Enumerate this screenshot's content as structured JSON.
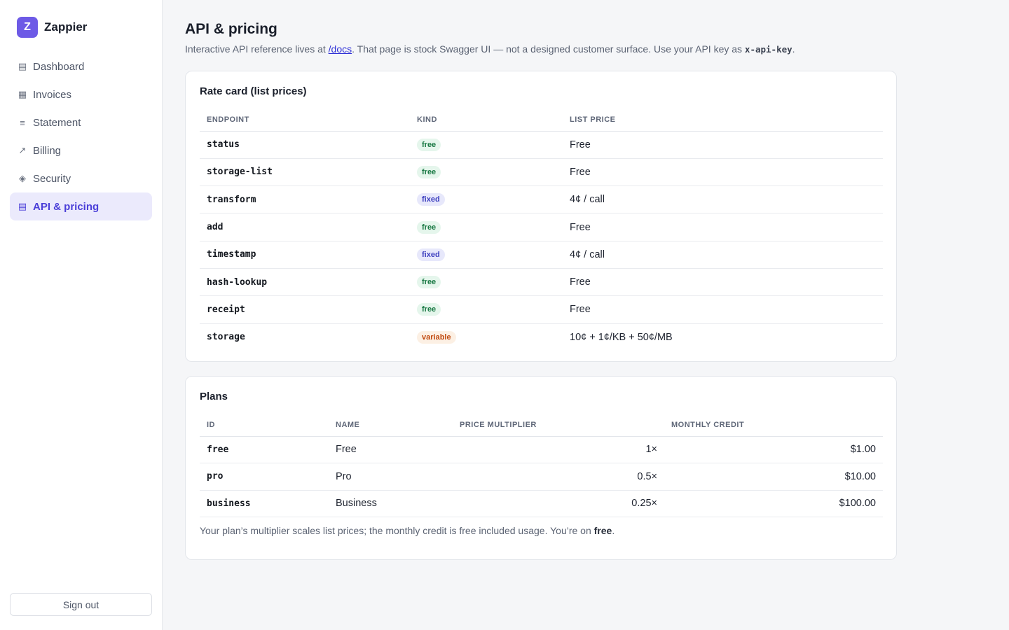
{
  "app": {
    "logo_letter": "Z",
    "name": "Zappier"
  },
  "sidebar": {
    "items": [
      {
        "label": "Dashboard",
        "icon": "▤"
      },
      {
        "label": "Invoices",
        "icon": "▦"
      },
      {
        "label": "Statement",
        "icon": "≡"
      },
      {
        "label": "Billing",
        "icon": "↗"
      },
      {
        "label": "Security",
        "icon": "◈"
      },
      {
        "label": "API & pricing",
        "icon": "▤"
      }
    ],
    "active_index": 5,
    "signout_label": "Sign out"
  },
  "page": {
    "title": "API & pricing",
    "subtitle_pre": "Interactive API reference lives at ",
    "subtitle_link": "/docs",
    "subtitle_mid": ". That page is stock Swagger UI — not a designed customer surface. Use your API key as ",
    "subtitle_code": "x-api-key",
    "subtitle_post": "."
  },
  "rate_card": {
    "title": "Rate card (list prices)",
    "columns": [
      "ENDPOINT",
      "KIND",
      "LIST PRICE"
    ],
    "rows": [
      {
        "endpoint": "status",
        "kind": "free",
        "price": "Free"
      },
      {
        "endpoint": "storage-list",
        "kind": "free",
        "price": "Free"
      },
      {
        "endpoint": "transform",
        "kind": "fixed",
        "price": "4¢ / call"
      },
      {
        "endpoint": "add",
        "kind": "free",
        "price": "Free"
      },
      {
        "endpoint": "timestamp",
        "kind": "fixed",
        "price": "4¢ / call"
      },
      {
        "endpoint": "hash-lookup",
        "kind": "free",
        "price": "Free"
      },
      {
        "endpoint": "receipt",
        "kind": "free",
        "price": "Free"
      },
      {
        "endpoint": "storage",
        "kind": "variable",
        "price": "10¢ + 1¢/KB + 50¢/MB"
      }
    ]
  },
  "plans": {
    "title": "Plans",
    "columns": [
      "ID",
      "NAME",
      "PRICE MULTIPLIER",
      "MONTHLY CREDIT"
    ],
    "rows": [
      {
        "id": "free",
        "name": "Free",
        "multiplier": "1×",
        "credit": "$1.00"
      },
      {
        "id": "pro",
        "name": "Pro",
        "multiplier": "0.5×",
        "credit": "$10.00"
      },
      {
        "id": "business",
        "name": "Business",
        "multiplier": "0.25×",
        "credit": "$100.00"
      }
    ],
    "footnote_pre": "Your plan’s multiplier scales list prices; the monthly credit is free included usage. You’re on ",
    "footnote_plan": "free",
    "footnote_post": "."
  }
}
